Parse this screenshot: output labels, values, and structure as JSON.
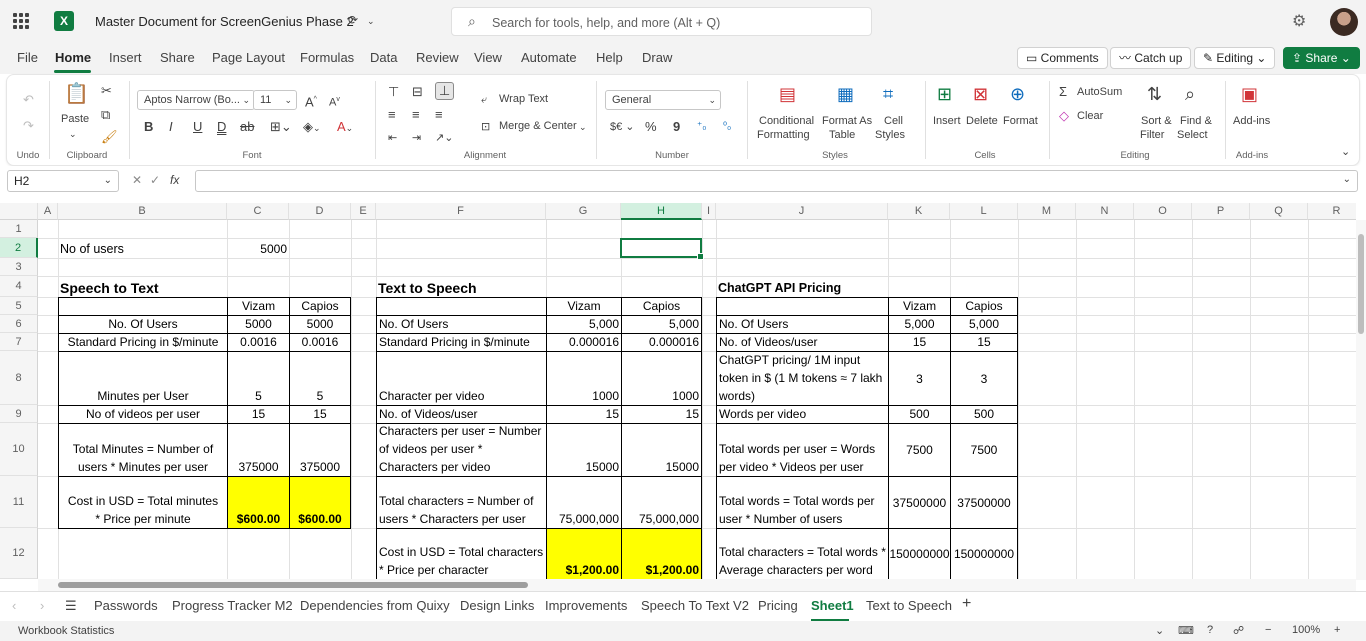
{
  "titlebar": {
    "doc_title": "Master Document for ScreenGenius Phase 2",
    "search_placeholder": "Search for tools, help, and more (Alt + Q)",
    "app_icon": "X"
  },
  "menu": {
    "items": [
      "File",
      "Home",
      "Insert",
      "Share",
      "Page Layout",
      "Formulas",
      "Data",
      "Review",
      "View",
      "Automate",
      "Help",
      "Draw"
    ],
    "comments": "Comments",
    "catchup": "Catch up",
    "editing": "Editing",
    "share": "Share"
  },
  "ribbon": {
    "undo_group": "Undo",
    "clipboard_group": "Clipboard",
    "paste": "Paste",
    "font_name": "Aptos Narrow (Bo...",
    "font_size": "11",
    "font_group": "Font",
    "wrap_text": "Wrap Text",
    "merge_center": "Merge & Center",
    "alignment_group": "Alignment",
    "number_format": "General",
    "number_group": "Number",
    "cond_fmt_1": "Conditional",
    "cond_fmt_2": "Formatting",
    "fmt_table_1": "Format As",
    "fmt_table_2": "Table",
    "cell_styles_1": "Cell",
    "cell_styles_2": "Styles",
    "styles_group": "Styles",
    "insert": "Insert",
    "delete": "Delete",
    "format": "Format",
    "cells_group": "Cells",
    "autosum": "AutoSum",
    "clear": "Clear",
    "sort_1": "Sort &",
    "sort_2": "Filter",
    "find_1": "Find &",
    "find_2": "Select",
    "editing_group": "Editing",
    "addins": "Add-ins",
    "addins_group": "Add-ins"
  },
  "formula_bar": {
    "name_box": "H2",
    "formula": ""
  },
  "columns": [
    "A",
    "B",
    "C",
    "D",
    "E",
    "F",
    "G",
    "H",
    "I",
    "J",
    "K",
    "L",
    "M",
    "N",
    "O",
    "P",
    "Q",
    "R"
  ],
  "rows": [
    "1",
    "2",
    "3",
    "4",
    "5",
    "6",
    "7",
    "8",
    "9",
    "10",
    "11",
    "12"
  ],
  "cells": {
    "B2": "No of users",
    "C2": "5000",
    "B4": "Speech to Text",
    "F4": "Text to Speech",
    "J4": "ChatGPT API Pricing",
    "C5": "Vizam",
    "D5": "Capios",
    "G5": "Vizam",
    "H5": "Capios",
    "K5": "Vizam",
    "L5": "Capios",
    "B6": "No. Of Users",
    "C6": "5000",
    "D6": "5000",
    "F6": "No. Of Users",
    "G6": "5,000",
    "H6": "5,000",
    "J6": "No. Of Users",
    "K6": "5,000",
    "L6": "5,000",
    "B7": "Standard Pricing in $/minute",
    "C7": "0.0016",
    "D7": "0.0016",
    "F7": "Standard Pricing in $/minute",
    "G7": "0.000016",
    "H7": "0.000016",
    "J7": "No. of Videos/user",
    "K7": "15",
    "L7": "15",
    "B8": "Minutes per User",
    "C8": "5",
    "D8": "5",
    "F8": "Character per video",
    "G8": "1000",
    "H8": "1000",
    "J8": "ChatGPT pricing/ 1M input token in $ (1 M tokens ≈ 7 lakh words)",
    "K8": "3",
    "L8": "3",
    "B9": "No of videos per user",
    "C9": "15",
    "D9": "15",
    "F9": "No. of Videos/user",
    "G9": "15",
    "H9": "15",
    "J9": "Words per video",
    "K9": "500",
    "L9": "500",
    "B10": "Total Minutes = Number of users * Minutes per user",
    "C10": "375000",
    "D10": "375000",
    "F10": "Characters per user = Number of videos per user * Characters per video",
    "G10": "15000",
    "H10": "15000",
    "J10": "Total words per user = Words per video * Videos per user",
    "K10": "7500",
    "L10": "7500",
    "B11": "Cost in USD = Total minutes * Price per minute",
    "C11": "$600.00",
    "D11": "$600.00",
    "F11": "Total characters = Number of users * Characters per user",
    "G11": "75,000,000",
    "H11": "75,000,000",
    "J11": "Total words = Total words per user * Number of users",
    "K11": "37500000",
    "L11": "37500000",
    "F12": "Cost in USD = Total characters * Price per character",
    "G12": "$1,200.00",
    "H12": "$1,200.00",
    "J12": "Total characters = Total words * Average characters per word",
    "K12": "150000000",
    "L12": "150000000"
  },
  "sheets": [
    "Passwords",
    "Progress Tracker M2",
    "Dependencies from Quixy",
    "Design Links",
    "Improvements",
    "Speech To Text V2",
    "Pricing",
    "Sheet1",
    "Text to Speech"
  ],
  "status": {
    "left": "Workbook Statistics",
    "zoom": "100%"
  },
  "colors": {
    "accent": "#107c41",
    "highlight": "#ffff00"
  }
}
